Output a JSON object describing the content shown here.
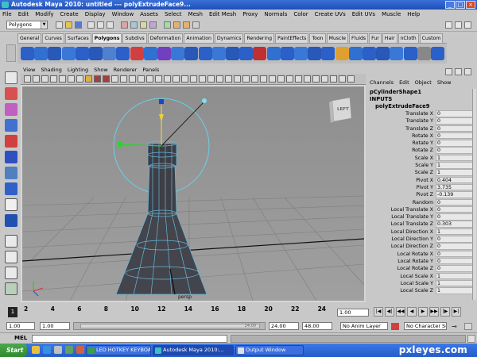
{
  "window": {
    "title": "Autodesk Maya 2010: untitled   ---   polyExtrudeFace9...",
    "buttons": [
      "_",
      "□",
      "×"
    ]
  },
  "menubar": [
    "File",
    "Edit",
    "Modify",
    "Create",
    "Display",
    "Window",
    "Assets",
    "Select",
    "Mesh",
    "Edit Mesh",
    "Proxy",
    "Normals",
    "Color",
    "Create UVs",
    "Edit UVs",
    "Muscle",
    "Help"
  ],
  "status_line": {
    "mode": "Polygons"
  },
  "shelf": {
    "tabs": [
      "General",
      "Curves",
      "Surfaces",
      "Polygons",
      "Subdivs",
      "Deformation",
      "Animation",
      "Dynamics",
      "Rendering",
      "PaintEffects",
      "Toon",
      "Muscle",
      "Fluids",
      "Fur",
      "Hair",
      "nCloth",
      "Custom"
    ],
    "active_tab": "Polygons"
  },
  "panel": {
    "menus": [
      "View",
      "Shading",
      "Lighting",
      "Show",
      "Renderer",
      "Panels"
    ],
    "viewcube_label": "LEFT",
    "camera_label": "persp"
  },
  "channel_box": {
    "menus": [
      "Channels",
      "Edit",
      "Object",
      "Show"
    ],
    "shape_name": "pCylinderShape1",
    "inputs_label": "INPUTS",
    "node_name": "polyExtrudeFace9",
    "attributes": [
      {
        "label": "Translate X",
        "value": "0"
      },
      {
        "label": "Translate Y",
        "value": "0"
      },
      {
        "label": "Translate Z",
        "value": "0"
      },
      {
        "label": "Rotate X",
        "value": "0"
      },
      {
        "label": "Rotate Y",
        "value": "0"
      },
      {
        "label": "Rotate Z",
        "value": "0"
      },
      {
        "label": "Scale X",
        "value": "1"
      },
      {
        "label": "Scale Y",
        "value": "1"
      },
      {
        "label": "Scale Z",
        "value": "1"
      },
      {
        "label": "Pivot X",
        "value": "0.404"
      },
      {
        "label": "Pivot Y",
        "value": "3.735"
      },
      {
        "label": "Pivot Z",
        "value": "-0.139"
      },
      {
        "label": "Random",
        "value": "0"
      },
      {
        "label": "Local Translate X",
        "value": "0"
      },
      {
        "label": "Local Translate Y",
        "value": "0"
      },
      {
        "label": "Local Translate Z",
        "value": "0.303"
      },
      {
        "label": "Local Direction X",
        "value": "1"
      },
      {
        "label": "Local Direction Y",
        "value": "0"
      },
      {
        "label": "Local Direction Z",
        "value": "0"
      },
      {
        "label": "Local Rotate X",
        "value": "0"
      },
      {
        "label": "Local Rotate Y",
        "value": "0"
      },
      {
        "label": "Local Rotate Z",
        "value": "0"
      },
      {
        "label": "Local Scale X",
        "value": "1"
      },
      {
        "label": "Local Scale Y",
        "value": "1"
      },
      {
        "label": "Local Scale Z",
        "value": "1"
      }
    ]
  },
  "timeline": {
    "ticks": [
      "2",
      "4",
      "6",
      "8",
      "10",
      "12",
      "14",
      "16",
      "18",
      "20",
      "22",
      "24"
    ],
    "current_frame": "1",
    "frame_field": "1.00",
    "playback_buttons": [
      "|◀",
      "◀|",
      "◀◀",
      "◀",
      "▶",
      "▶▶",
      "|▶",
      "▶|"
    ]
  },
  "range": {
    "start": "1.00",
    "playback_start": "1.00",
    "slider_end": "24.00",
    "end": "24.00",
    "playback_end": "48.00",
    "anim_layer": "No Anim Layer",
    "char_set": "No Character Set"
  },
  "command_line": {
    "label": "MEL"
  },
  "taskbar": {
    "start": "Start",
    "tasks": [
      {
        "label": "LED HOTKEY KEYBOARD",
        "active": false
      },
      {
        "label": "Autodesk Maya 2010:...",
        "active": true
      },
      {
        "label": "Output Window",
        "active": false
      }
    ],
    "watermark": "pxleyes.com"
  }
}
